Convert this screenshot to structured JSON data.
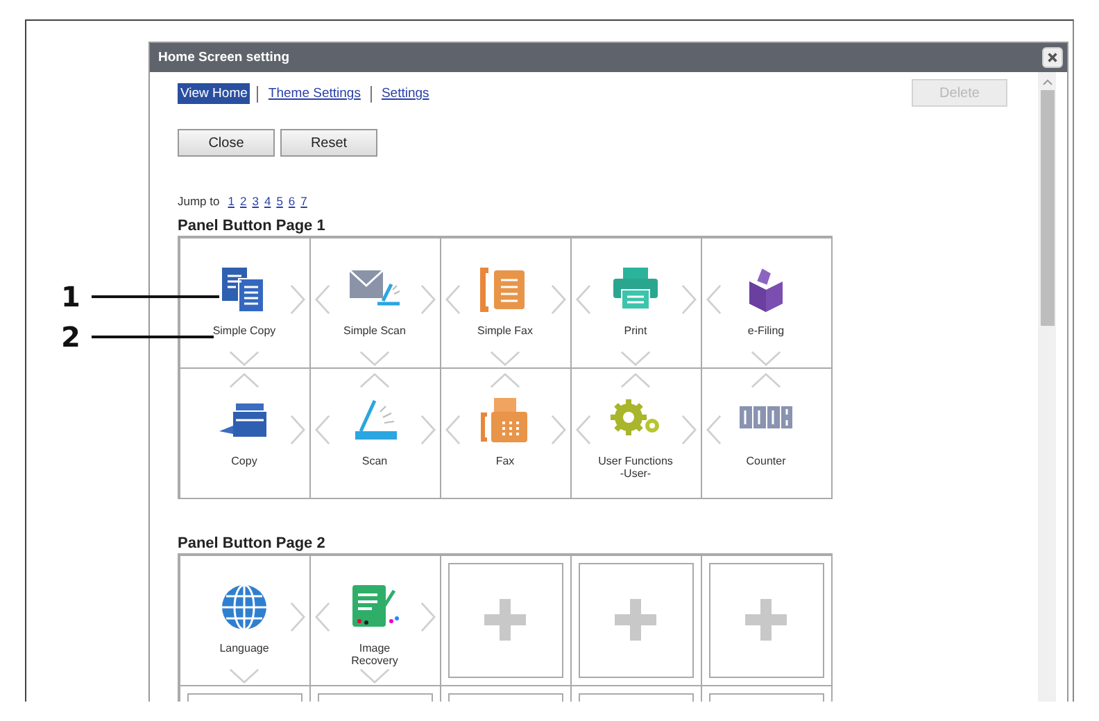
{
  "window": {
    "title": "Home Screen setting"
  },
  "tabs": [
    {
      "label": "View Home",
      "selected": true
    },
    {
      "label": "Theme Settings",
      "selected": false
    },
    {
      "label": "Settings",
      "selected": false
    }
  ],
  "delete_button": {
    "label": "Delete",
    "disabled": true
  },
  "buttons": [
    "Close",
    "Reset"
  ],
  "jump": {
    "label": "Jump to",
    "pages": [
      "1",
      "2",
      "3",
      "4",
      "5",
      "6",
      "7"
    ]
  },
  "panel_pages": [
    {
      "title": "Panel Button Page 1",
      "rows": [
        [
          {
            "kind": "app",
            "label": "Simple Copy"
          },
          {
            "kind": "app",
            "label": "Simple Scan"
          },
          {
            "kind": "app",
            "label": "Simple Fax"
          },
          {
            "kind": "app",
            "label": "Print"
          },
          {
            "kind": "app",
            "label": "e-Filing"
          }
        ],
        [
          {
            "kind": "app",
            "label": "Copy"
          },
          {
            "kind": "app",
            "label": "Scan"
          },
          {
            "kind": "app",
            "label": "Fax"
          },
          {
            "kind": "app",
            "label": "User Functions\n-User-"
          },
          {
            "kind": "app",
            "label": "Counter"
          }
        ]
      ]
    },
    {
      "title": "Panel Button Page 2",
      "rows": [
        [
          {
            "kind": "app",
            "label": "Language"
          },
          {
            "kind": "app",
            "label": "Image\nRecovery"
          },
          {
            "kind": "empty"
          },
          {
            "kind": "empty"
          },
          {
            "kind": "empty"
          }
        ],
        [
          {
            "kind": "empty"
          },
          {
            "kind": "empty"
          },
          {
            "kind": "empty"
          },
          {
            "kind": "empty"
          },
          {
            "kind": "empty"
          }
        ]
      ]
    }
  ],
  "callouts": [
    {
      "number": "1"
    },
    {
      "number": "2"
    }
  ]
}
